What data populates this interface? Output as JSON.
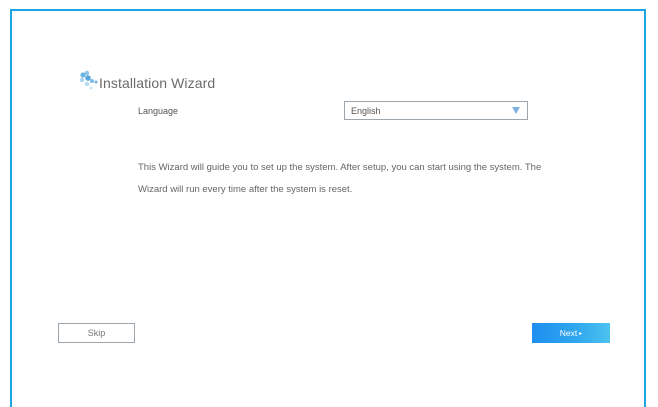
{
  "wizard": {
    "title": "Installation Wizard",
    "language_label": "Language",
    "language_value": "English",
    "description": "This Wizard will guide you to set up the system. After setup, you can start using the system. The Wizard will run every time after the system is reset."
  },
  "buttons": {
    "skip_label": "Skip",
    "next_label": "Next",
    "next_arrow": "▸"
  },
  "colors": {
    "frame_border": "#1aa6e0",
    "next_button": "#1e8ff0",
    "logo_dark": "#6fb3e2",
    "logo_light": "#a9d3ef"
  },
  "icons": {
    "logo": "wizard-logo-icon",
    "dropdown": "dropdown-arrow-icon"
  }
}
